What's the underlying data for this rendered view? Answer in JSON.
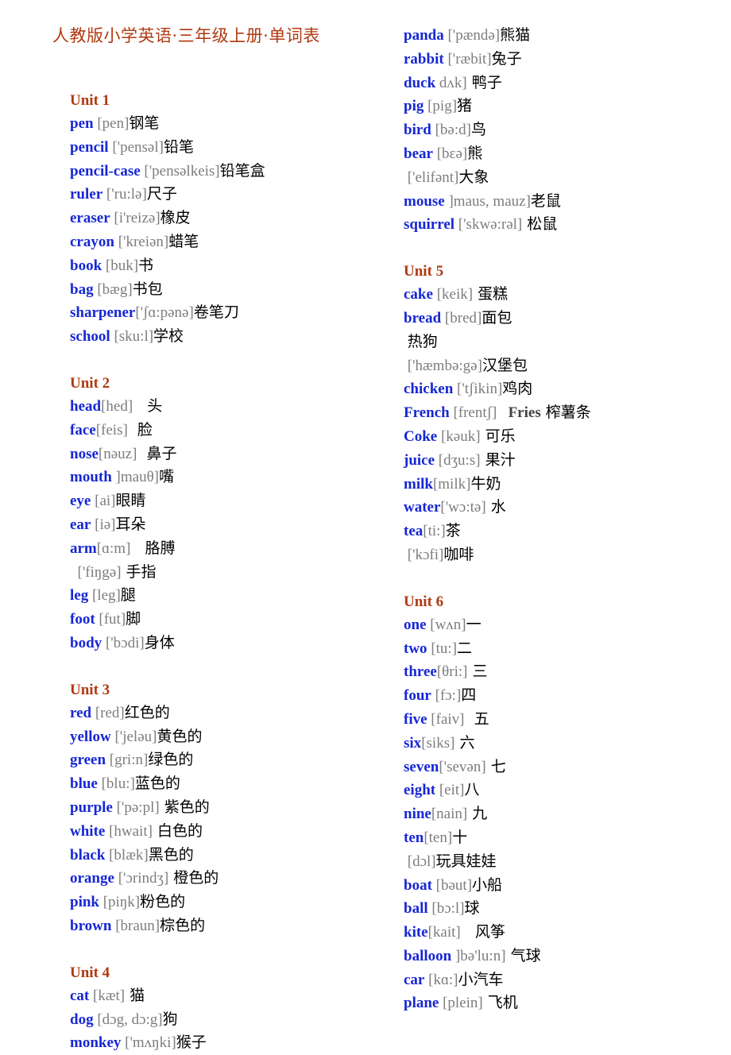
{
  "document": {
    "title": "人教版小学英语·三年级上册·单词表",
    "colors": {
      "title": "#B03A11",
      "unit_heading": "#B03A11",
      "english_word": "#1727D5",
      "phonetic": "#7d7d7d",
      "chinese": "#000000",
      "dark_word": "#444444",
      "background": "#ffffff"
    }
  },
  "columns": {
    "left": [
      {
        "type": "unit",
        "label": "Unit 1",
        "entries": [
          {
            "word": "pen",
            "phonetic": " [pen]",
            "chinese": "钢笔"
          },
          {
            "word": "pencil",
            "phonetic": " ['pensəl]",
            "chinese": "铅笔"
          },
          {
            "word": "pencil-case",
            "phonetic": " ['pensəlkeis]",
            "chinese": "铅笔盒"
          },
          {
            "word": "ruler",
            "phonetic": " ['ru:lə]",
            "chinese": "尺子"
          },
          {
            "word": "eraser",
            "phonetic": " [i'reizə]",
            "chinese": "橡皮"
          },
          {
            "word": "crayon",
            "phonetic": " ['kreiən]",
            "chinese": "蜡笔"
          },
          {
            "word": "book",
            "phonetic": " [buk]",
            "chinese": "书"
          },
          {
            "word": "bag",
            "phonetic": " [bæg]",
            "chinese": "书包"
          },
          {
            "word": "sharpener",
            "phonetic": "['ʃɑ:pənə]",
            "chinese": "卷笔刀"
          },
          {
            "word": "school",
            "phonetic": " [sku:l]",
            "chinese": "学校"
          }
        ]
      },
      {
        "type": "unit",
        "label": "Unit 2",
        "entries": [
          {
            "word": "head",
            "phonetic": "[hed]",
            "chinese": "   头"
          },
          {
            "word": "face",
            "phonetic": "[feis]",
            "chinese": "  脸"
          },
          {
            "word": "nose",
            "phonetic": "[nəuz]",
            "chinese": "  鼻子"
          },
          {
            "word": "mouth",
            "phonetic": " ]mauθ]",
            "chinese": "嘴"
          },
          {
            "word": "eye",
            "phonetic": " [ai]",
            "chinese": "眼睛"
          },
          {
            "word": "ear",
            "phonetic": " [iə]",
            "chinese": "耳朵"
          },
          {
            "word": "arm",
            "phonetic": "[ɑ:m]",
            "chinese": "   胳膊"
          },
          {
            "word": "",
            "phonetic": "  ['fiŋgə]",
            "chinese": " 手指"
          },
          {
            "word": "leg",
            "phonetic": " [leg]",
            "chinese": "腿"
          },
          {
            "word": "foot",
            "phonetic": " [fut]",
            "chinese": "脚"
          },
          {
            "word": "body",
            "phonetic": " ['bɔdi]",
            "chinese": "身体"
          }
        ]
      },
      {
        "type": "unit",
        "label": "Unit 3",
        "entries": [
          {
            "word": "red",
            "phonetic": " [red]",
            "chinese": "红色的"
          },
          {
            "word": "yellow",
            "phonetic": " ['jeləu]",
            "chinese": "黄色的"
          },
          {
            "word": "green",
            "phonetic": " [gri:n]",
            "chinese": "绿色的"
          },
          {
            "word": "blue",
            "phonetic": " [blu:]",
            "chinese": "蓝色的"
          },
          {
            "word": "purple",
            "phonetic": " ['pə:pl]",
            "chinese": " 紫色的"
          },
          {
            "word": "white",
            "phonetic": " [hwait]",
            "chinese": " 白色的"
          },
          {
            "word": "black",
            "phonetic": " [blæk]",
            "chinese": "黑色的"
          },
          {
            "word": "orange",
            "phonetic": " ['ɔrindʒ]",
            "chinese": " 橙色的"
          },
          {
            "word": "pink",
            "phonetic": " [piŋk]",
            "chinese": "粉色的"
          },
          {
            "word": "brown",
            "phonetic": " [braun]",
            "chinese": "棕色的"
          }
        ]
      },
      {
        "type": "unit",
        "label": "Unit 4",
        "entries": [
          {
            "word": "cat",
            "phonetic": " [kæt]",
            "chinese": " 猫"
          },
          {
            "word": "dog",
            "phonetic": " [dɔg, dɔ:g]",
            "chinese": "狗"
          },
          {
            "word": "monkey",
            "phonetic": " ['mʌŋki]",
            "chinese": "猴子"
          }
        ]
      }
    ],
    "right": [
      {
        "type": "continuation",
        "label": "",
        "entries": [
          {
            "word": "panda",
            "phonetic": " ['pændə]",
            "chinese": "熊猫"
          },
          {
            "word": "rabbit",
            "phonetic": " ['ræbit]",
            "chinese": "兔子"
          },
          {
            "word": "duck",
            "phonetic": " dʌk]",
            "chinese": " 鸭子"
          },
          {
            "word": "pig",
            "phonetic": " [pig]",
            "chinese": "猪"
          },
          {
            "word": "bird",
            "phonetic": " [bə:d]",
            "chinese": "鸟"
          },
          {
            "word": "bear",
            "phonetic": " [bɛə]",
            "chinese": "熊"
          },
          {
            "word": "",
            "phonetic": " ['elifənt]",
            "chinese": "大象"
          },
          {
            "word": "mouse",
            "phonetic": " ]maus, mauz]",
            "chinese": "老鼠"
          },
          {
            "word": "squirrel",
            "phonetic": " ['skwə:rəl]",
            "chinese": " 松鼠"
          }
        ]
      },
      {
        "type": "unit",
        "label": "Unit 5",
        "entries": [
          {
            "word": "cake",
            "phonetic": " [keik]",
            "chinese": " 蛋糕"
          },
          {
            "word": "bread",
            "phonetic": " [bred]",
            "chinese": "面包"
          },
          {
            "word": "",
            "phonetic": " ",
            "chinese": "热狗"
          },
          {
            "word": "",
            "phonetic": " ['hæmbə:gə]",
            "chinese": "汉堡包"
          },
          {
            "word": "chicken",
            "phonetic": " ['tʃikin]",
            "chinese": "鸡肉"
          },
          {
            "word": "French",
            "phonetic": " [frentʃ]",
            "dark_word": "   Fries",
            "chinese": " 榨薯条"
          },
          {
            "word": "Coke",
            "phonetic": " [kəuk]",
            "chinese": " 可乐"
          },
          {
            "word": "juice",
            "phonetic": " [dʒu:s]",
            "chinese": " 果汁"
          },
          {
            "word": "milk",
            "phonetic": "[milk]",
            "chinese": "牛奶"
          },
          {
            "word": "water",
            "phonetic": "['wɔ:tə]",
            "chinese": " 水"
          },
          {
            "word": "tea",
            "phonetic": "[ti:]",
            "chinese": "茶"
          },
          {
            "word": "",
            "phonetic": " ['kɔfi]",
            "chinese": "咖啡"
          }
        ]
      },
      {
        "type": "unit",
        "label": "Unit 6",
        "entries": [
          {
            "word": "one",
            "phonetic": " [wʌn]",
            "chinese": "一"
          },
          {
            "word": "two",
            "phonetic": " [tu:]",
            "chinese": "二"
          },
          {
            "word": "three",
            "phonetic": "[θri:]",
            "chinese": " 三"
          },
          {
            "word": "four",
            "phonetic": " [fɔ:]",
            "chinese": "四"
          },
          {
            "word": "five",
            "phonetic": " [faiv]",
            "chinese": "  五"
          },
          {
            "word": "six",
            "phonetic": "[siks]",
            "chinese": " 六"
          },
          {
            "word": "seven",
            "phonetic": "['sevən]",
            "chinese": " 七"
          },
          {
            "word": "eight",
            "phonetic": " [eit]",
            "chinese": "八"
          },
          {
            "word": "nine",
            "phonetic": "[nain]",
            "chinese": " 九"
          },
          {
            "word": "ten",
            "phonetic": "[ten]",
            "chinese": "十"
          },
          {
            "word": "",
            "phonetic": " [dɔl]",
            "chinese": "玩具娃娃"
          },
          {
            "word": "boat",
            "phonetic": " [bəut]",
            "chinese": "小船"
          },
          {
            "word": "ball",
            "phonetic": " [bɔ:l]",
            "chinese": "球"
          },
          {
            "word": "kite",
            "phonetic": "[kait]",
            "chinese": "   风筝"
          },
          {
            "word": "balloon",
            "phonetic": " ]bə'lu:n]",
            "chinese": " 气球"
          },
          {
            "word": "car",
            "phonetic": " [kɑ:]",
            "chinese": "小汽车"
          },
          {
            "word": "plane",
            "phonetic": " [plein]",
            "chinese": " 飞机"
          }
        ]
      }
    ]
  }
}
